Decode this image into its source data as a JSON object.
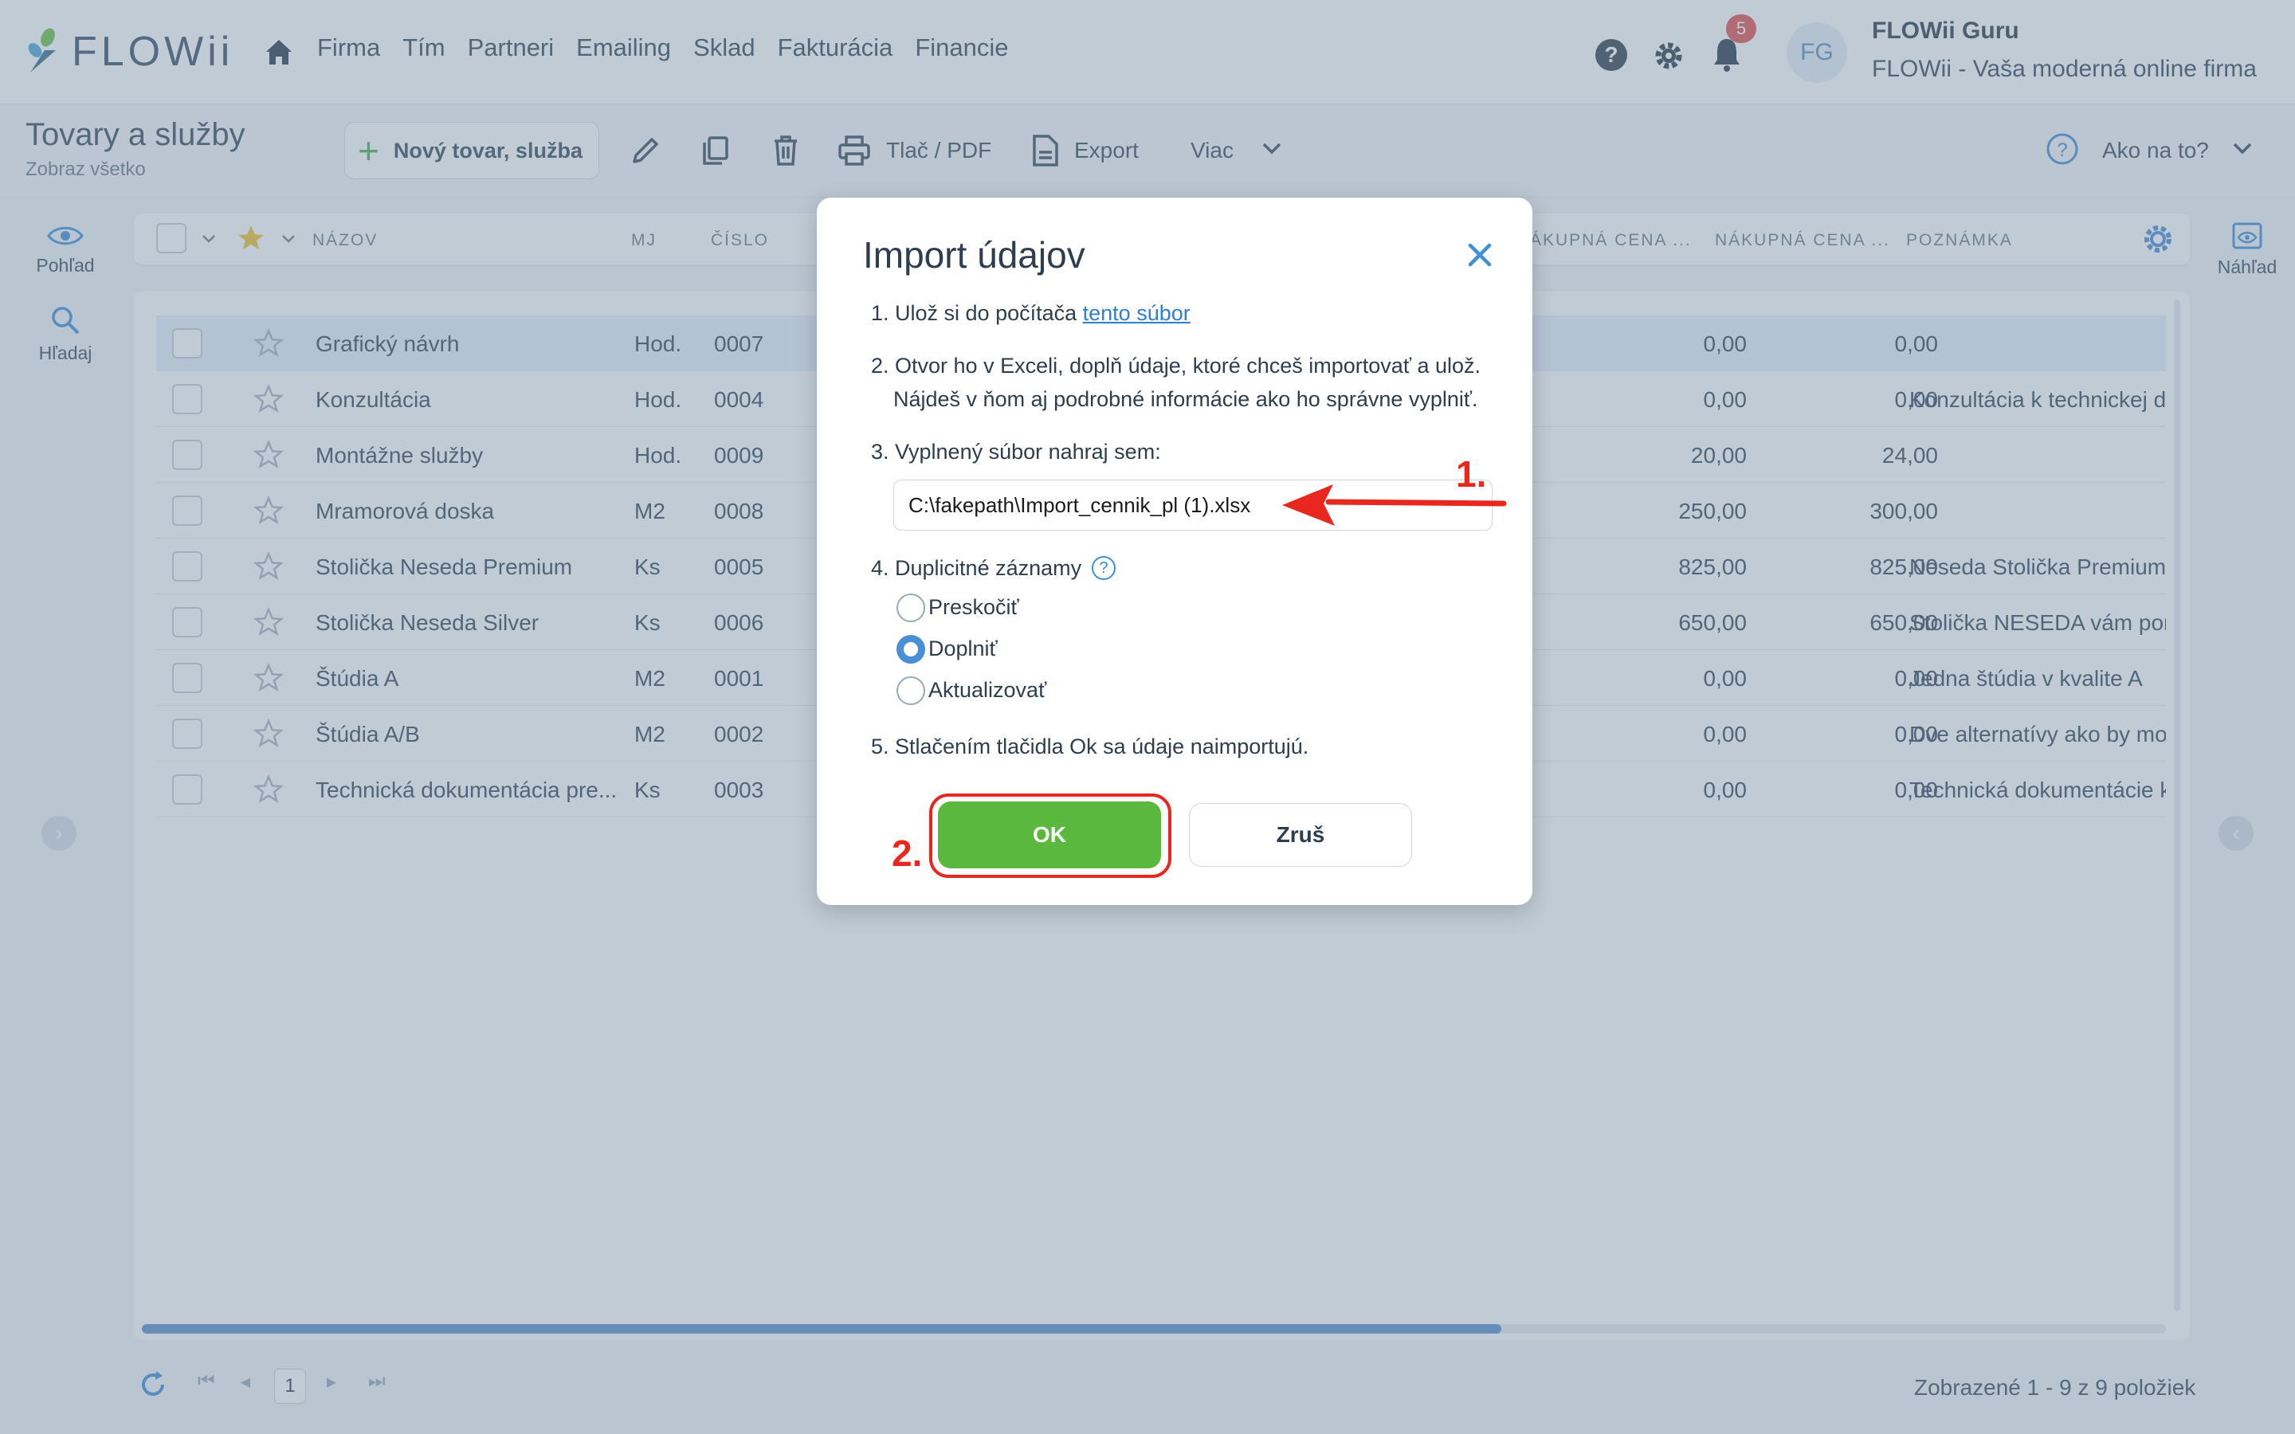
{
  "brand": {
    "logo_text": "FLOWii"
  },
  "nav": {
    "items": [
      "Firma",
      "Tím",
      "Partneri",
      "Emailing",
      "Sklad",
      "Fakturácia",
      "Financie"
    ]
  },
  "header": {
    "help_glyph": "?",
    "notification_count": "5",
    "avatar_initials": "FG",
    "user_name": "FLOWii Guru",
    "company": "FLOWii - Vaša moderná online firma"
  },
  "toolbar": {
    "title": "Tovary a služby",
    "subtitle": "Zobraz všetko",
    "new_label": "Nový tovar, služba",
    "print_label": "Tlač / PDF",
    "export_label": "Export",
    "more_label": "Viac",
    "help_label": "Ako na to?"
  },
  "rails": {
    "view_label": "Pohľad",
    "search_label": "Hľadaj",
    "preview_label": "Náhľad"
  },
  "grid": {
    "headers": {
      "name": "NÁZOV",
      "unit": "MJ",
      "number": "ČÍSLO",
      "purchase1": "ÁKUPNÁ CENA ...",
      "purchase2": "NÁKUPNÁ CENA ...",
      "note": "POZNÁMKA"
    },
    "rows": [
      {
        "name": "Grafický návrh",
        "unit": "Hod.",
        "number": "0007",
        "p1": "0,00",
        "p2": "0,00",
        "note": ""
      },
      {
        "name": "Konzultácia",
        "unit": "Hod.",
        "number": "0004",
        "p1": "0,00",
        "p2": "0,00",
        "note": "Konzultácia k technickej do"
      },
      {
        "name": "Montážne služby",
        "unit": "Hod.",
        "number": "0009",
        "p1": "20,00",
        "p2": "24,00",
        "note": ""
      },
      {
        "name": "Mramorová doska",
        "unit": "M2",
        "number": "0008",
        "p1": "250,00",
        "p2": "300,00",
        "note": ""
      },
      {
        "name": "Stolička Neseda Premium",
        "unit": "Ks",
        "number": "0005",
        "p1": "825,00",
        "p2": "825,00",
        "note": "Neseda Stolička Premium -"
      },
      {
        "name": "Stolička Neseda Silver",
        "unit": "Ks",
        "number": "0006",
        "p1": "650,00",
        "p2": "650,00",
        "note": "Stolička NESEDA vám pom"
      },
      {
        "name": "Štúdia A",
        "unit": "M2",
        "number": "0001",
        "p1": "0,00",
        "p2": "0,00",
        "note": "Jedna štúdia v kvalite A"
      },
      {
        "name": "Štúdia A/B",
        "unit": "M2",
        "number": "0002",
        "p1": "0,00",
        "p2": "0,00",
        "note": "Dve alternatívy ako by moh"
      },
      {
        "name": "Technická dokumentácia pre...",
        "unit": "Ks",
        "number": "0003",
        "p1": "0,00",
        "p2": "0,00",
        "note": "Technická dokumentácie k"
      }
    ]
  },
  "pager": {
    "current_page": "1",
    "info": "Zobrazené 1 - 9 z 9 položiek"
  },
  "modal": {
    "title": "Import údajov",
    "step1_prefix": "1. Ulož si do počítača ",
    "step1_link": "tento súbor",
    "step2_line1": "2. Otvor ho v Exceli, doplň údaje, ktoré chceš importovať a ulož.",
    "step2_line2": "Nájdeš v ňom aj podrobné informácie ako ho správne vyplniť.",
    "step3": "3. Vyplnený súbor nahraj sem:",
    "file_value": "C:\\fakepath\\Import_cennik_pl (1).xlsx",
    "step4": "4. Duplicitné záznamy",
    "options": [
      "Preskočiť",
      "Doplniť",
      "Aktualizovať"
    ],
    "selected_option": "Doplniť",
    "step5": "5. Stlačením tlačidla Ok sa údaje naimportujú.",
    "ok_label": "OK",
    "cancel_label": "Zruš"
  },
  "annotations": {
    "mark1": "1.",
    "mark2": "2.",
    "color": "#e8281e"
  }
}
